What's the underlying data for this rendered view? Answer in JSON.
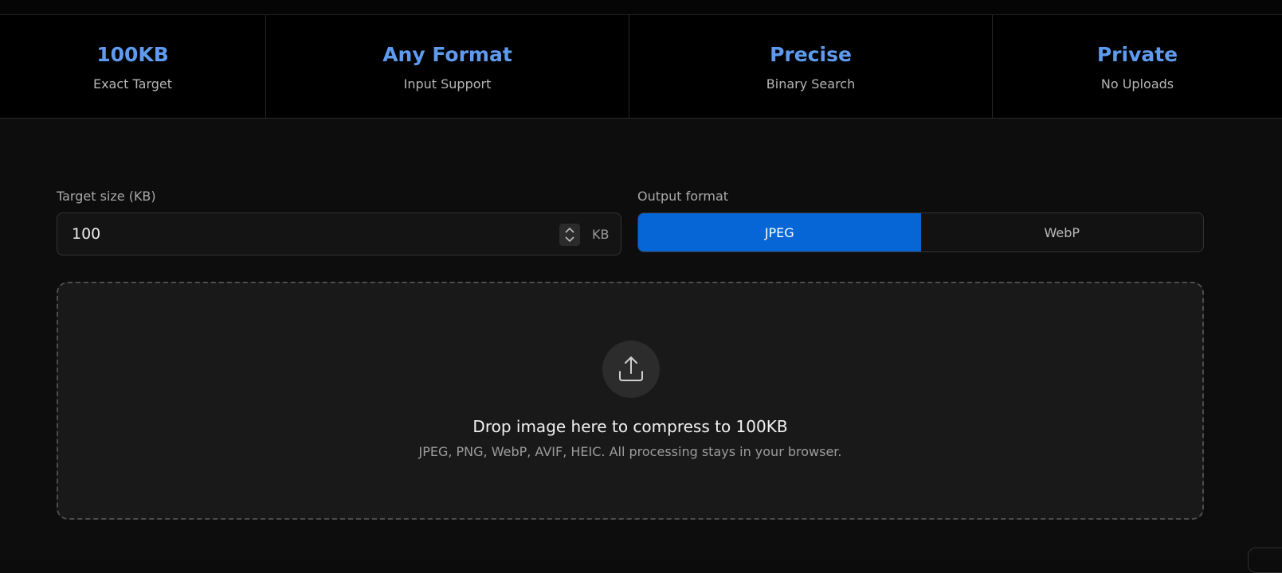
{
  "stats": [
    {
      "value": "100KB",
      "label": "Exact Target"
    },
    {
      "value": "Any Format",
      "label": "Input Support"
    },
    {
      "value": "Precise",
      "label": "Binary Search"
    },
    {
      "value": "Private",
      "label": "No Uploads"
    }
  ],
  "target_size": {
    "label": "Target size (KB)",
    "value": "100",
    "unit": "KB"
  },
  "output_format": {
    "label": "Output format",
    "options": [
      "JPEG",
      "WebP"
    ],
    "selected": "JPEG"
  },
  "dropzone": {
    "title": "Drop image here to compress to 100KB",
    "subtitle": "JPEG, PNG, WebP, AVIF, HEIC. All processing stays in your browser.",
    "icon": "upload-icon"
  },
  "colors": {
    "accent": "#0766d6",
    "stat_value": "#5e9bef",
    "background": "#0d0d0d"
  }
}
